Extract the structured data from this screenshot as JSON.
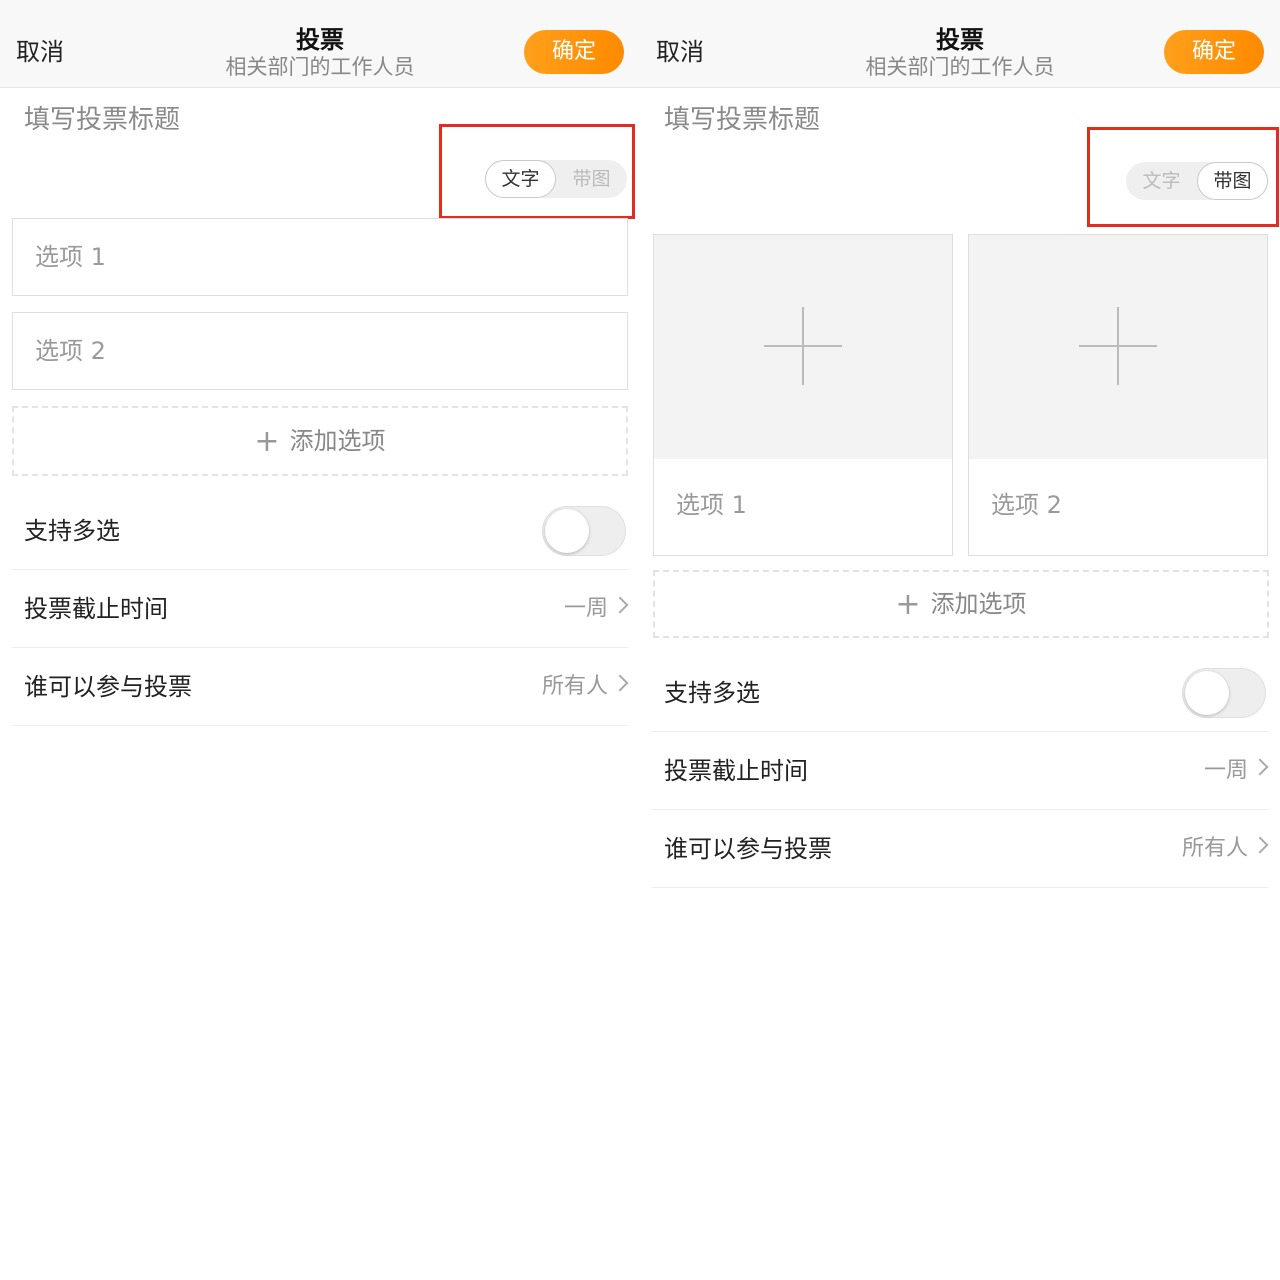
{
  "screens": [
    {
      "id": "text-mode",
      "nav": {
        "cancel": "取消",
        "title": "投票",
        "subtitle": "相关部门的工作人员",
        "confirm": "确定"
      },
      "title_placeholder": "填写投票标题",
      "mode_toggle": {
        "text": "文字",
        "image": "带图",
        "selected": "文字"
      },
      "options": [
        {
          "placeholder": "选项 1"
        },
        {
          "placeholder": "选项 2"
        }
      ],
      "add_option": "添加选项",
      "settings": {
        "multi_select": {
          "label": "支持多选",
          "enabled": false
        },
        "deadline": {
          "label": "投票截止时间",
          "value": "一周"
        },
        "participants": {
          "label": "谁可以参与投票",
          "value": "所有人"
        }
      }
    },
    {
      "id": "image-mode",
      "nav": {
        "cancel": "取消",
        "title": "投票",
        "subtitle": "相关部门的工作人员",
        "confirm": "确定"
      },
      "title_placeholder": "填写投票标题",
      "mode_toggle": {
        "text": "文字",
        "image": "带图",
        "selected": "带图"
      },
      "options": [
        {
          "placeholder": "选项 1"
        },
        {
          "placeholder": "选项 2"
        }
      ],
      "add_option": "添加选项",
      "settings": {
        "multi_select": {
          "label": "支持多选",
          "enabled": false
        },
        "deadline": {
          "label": "投票截止时间",
          "value": "一周"
        },
        "participants": {
          "label": "谁可以参与投票",
          "value": "所有人"
        }
      }
    }
  ],
  "colors": {
    "accent": "#ff9500",
    "highlight_box": "#e32a23"
  },
  "icons": {
    "add": "plus-icon",
    "disclosure": "chevron-right-icon"
  }
}
